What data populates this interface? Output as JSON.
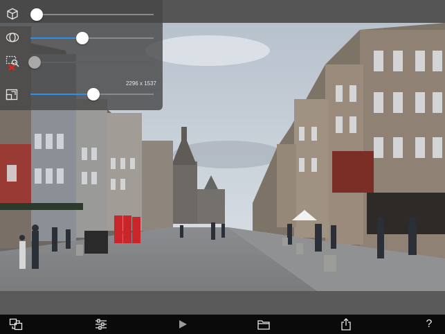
{
  "panel": {
    "resolution_label": "2296 x 1537",
    "sliders": [
      {
        "name": "depth",
        "value": 0.05,
        "enabled": true
      },
      {
        "name": "field-of-view",
        "value": 0.42,
        "enabled": true
      },
      {
        "name": "zoom",
        "value": 0.05,
        "enabled": false
      },
      {
        "name": "size",
        "value": 0.51,
        "enabled": true
      }
    ]
  },
  "toolbar": {
    "help_label": "?"
  },
  "colors": {
    "accent": "#2f8ff0",
    "panel_bg": "#464646",
    "toolbar_bg": "#0a0a0a"
  }
}
